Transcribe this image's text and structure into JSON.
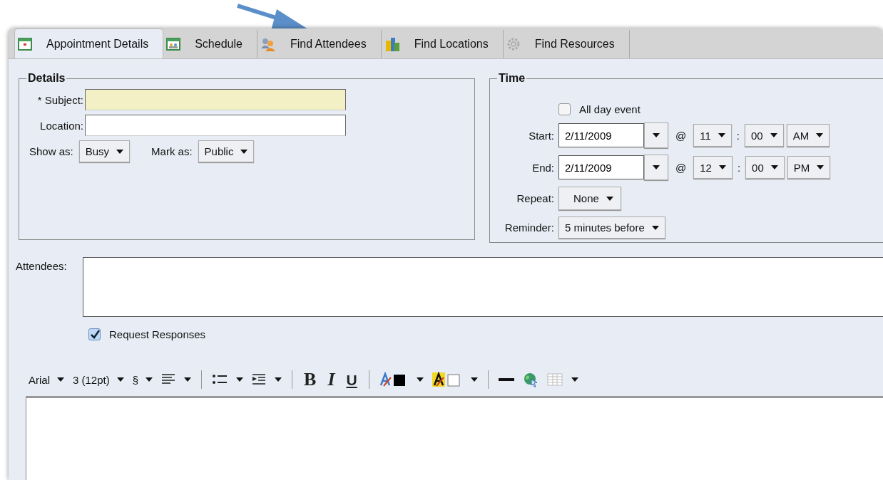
{
  "tabs": [
    {
      "label": "Appointment Details",
      "selected": true,
      "kind": "calendar"
    },
    {
      "label": "Schedule",
      "selected": false,
      "kind": "schedule"
    },
    {
      "label": "Find Attendees",
      "selected": false,
      "kind": "people"
    },
    {
      "label": "Find Locations",
      "selected": false,
      "kind": "buildings"
    },
    {
      "label": "Find Resources",
      "selected": false,
      "kind": "gear"
    }
  ],
  "details": {
    "title": "Details",
    "subject": {
      "label": "* Subject:",
      "required": true
    },
    "location": {
      "label": "Location:",
      "required": false
    },
    "show_as": {
      "label": "Show as:",
      "value": "Busy"
    },
    "mark_as": {
      "label": "Mark as:",
      "value": "Public"
    }
  },
  "time": {
    "title": "Time",
    "all_day": {
      "label": "All day event",
      "checked": false
    },
    "rows": [
      {
        "label": "Start:",
        "date": "2/11/2009",
        "at": "@",
        "hour": "11",
        "sep": ":",
        "minute": "00",
        "ampm": "AM"
      },
      {
        "label": "End:",
        "date": "2/11/2009",
        "at": "@",
        "hour": "12",
        "sep": ":",
        "minute": "00",
        "ampm": "PM"
      }
    ],
    "repeat": {
      "label": "Repeat:",
      "value": "None"
    },
    "reminder": {
      "label": "Reminder:",
      "value": "5 minutes before"
    }
  },
  "attendees": {
    "label": "Attendees:"
  },
  "request_responses": {
    "label": "Request Responses",
    "checked": true
  },
  "toolbar": [
    {
      "kind": "font-menu",
      "label": "Arial"
    },
    {
      "kind": "font-menu",
      "label": "3 (12pt)"
    },
    {
      "kind": "font-menu",
      "label": "§"
    },
    {
      "kind": "align-menu"
    },
    {
      "kind": "separator"
    },
    {
      "kind": "list-menu"
    },
    {
      "kind": "indent-menu"
    },
    {
      "kind": "separator"
    },
    {
      "kind": "bold",
      "label": "B"
    },
    {
      "kind": "italic",
      "label": "I"
    },
    {
      "kind": "underline",
      "label": "U"
    },
    {
      "kind": "separator"
    },
    {
      "kind": "font-color-menu"
    },
    {
      "kind": "highlight-menu"
    },
    {
      "kind": "separator"
    },
    {
      "kind": "rule"
    },
    {
      "kind": "link"
    },
    {
      "kind": "table-menu"
    }
  ]
}
